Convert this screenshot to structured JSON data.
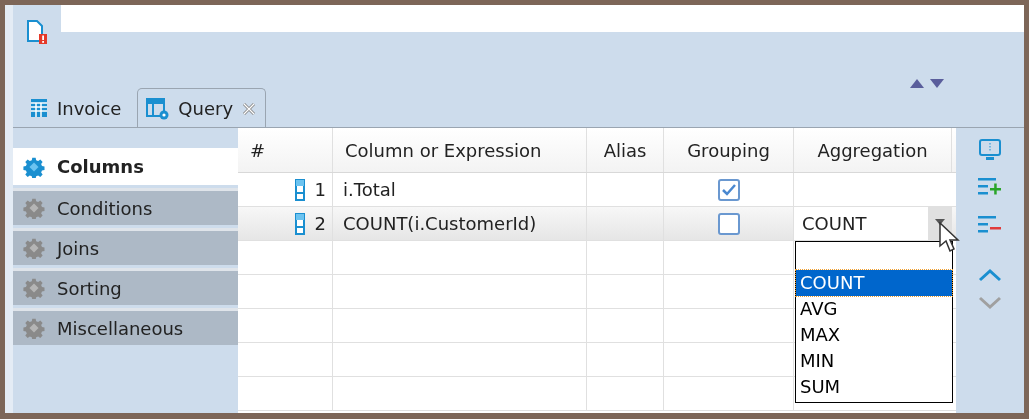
{
  "tabs": [
    {
      "label": "Invoice",
      "selected": false,
      "closable": false,
      "kind": "table"
    },
    {
      "label": "Query",
      "selected": true,
      "closable": true,
      "kind": "query"
    }
  ],
  "sort_arrows": {
    "up_disabled": false,
    "down_disabled": false
  },
  "sidebar": {
    "items": [
      {
        "label": "Columns",
        "selected": true
      },
      {
        "label": "Conditions",
        "selected": false
      },
      {
        "label": "Joins",
        "selected": false
      },
      {
        "label": "Sorting",
        "selected": false
      },
      {
        "label": "Miscellaneous",
        "selected": false
      }
    ]
  },
  "table": {
    "columns": [
      "#",
      "Column or Expression",
      "Alias",
      "Grouping",
      "Aggregation"
    ],
    "rows": [
      {
        "number": "1",
        "expression": "i.Total",
        "alias": "",
        "grouping": true,
        "aggregation": "",
        "selected": false,
        "editing": false
      },
      {
        "number": "2",
        "expression": "COUNT(i.CustomerId)",
        "alias": "",
        "grouping": false,
        "aggregation": "COUNT",
        "selected": true,
        "editing": true
      }
    ]
  },
  "dropdown": {
    "options": [
      {
        "label": "COUNT",
        "selected": true
      },
      {
        "label": "AVG",
        "selected": false
      },
      {
        "label": "MAX",
        "selected": false
      },
      {
        "label": "MIN",
        "selected": false
      },
      {
        "label": "SUM",
        "selected": false
      }
    ]
  },
  "toolbar": [
    {
      "kind": "preview",
      "disabled": false
    },
    {
      "kind": "add",
      "disabled": false
    },
    {
      "kind": "remove",
      "disabled": false
    },
    {
      "kind": "up",
      "disabled": false
    },
    {
      "kind": "down",
      "disabled": true
    }
  ]
}
